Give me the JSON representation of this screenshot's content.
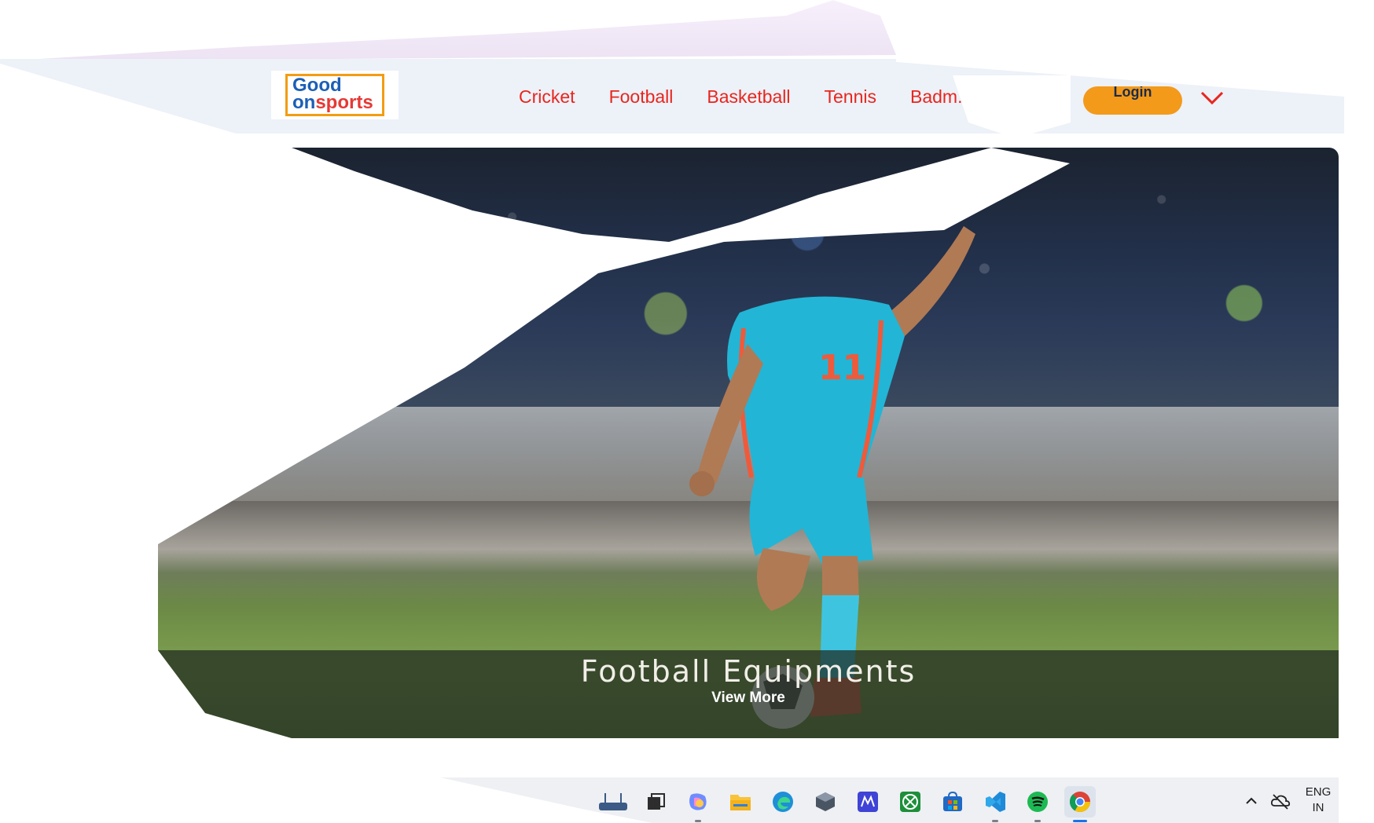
{
  "header": {
    "logo": {
      "line1": "Good",
      "line2_a": "on",
      "line2_b": "sports"
    },
    "nav": [
      {
        "label": "Cricket"
      },
      {
        "label": "Football"
      },
      {
        "label": "Basketball"
      },
      {
        "label": "Tennis"
      },
      {
        "label": "Badm..."
      }
    ],
    "login_label": "Login",
    "colors": {
      "nav_text": "#e8261e",
      "login_bg": "#f39a1a",
      "header_bg": "#edf1f8"
    }
  },
  "hero": {
    "title": "Football Equipments",
    "link": "View More",
    "jersey_number": "11"
  },
  "taskbar": {
    "icons": [
      {
        "name": "router-icon"
      },
      {
        "name": "task-view-icon"
      },
      {
        "name": "copilot-icon"
      },
      {
        "name": "file-explorer-icon"
      },
      {
        "name": "edge-icon"
      },
      {
        "name": "app-cube-icon"
      },
      {
        "name": "app-m-icon"
      },
      {
        "name": "xbox-icon"
      },
      {
        "name": "store-icon"
      },
      {
        "name": "vscode-icon"
      },
      {
        "name": "spotify-icon"
      },
      {
        "name": "chrome-icon"
      }
    ],
    "lang_line1": "ENG",
    "lang_line2": "IN"
  }
}
